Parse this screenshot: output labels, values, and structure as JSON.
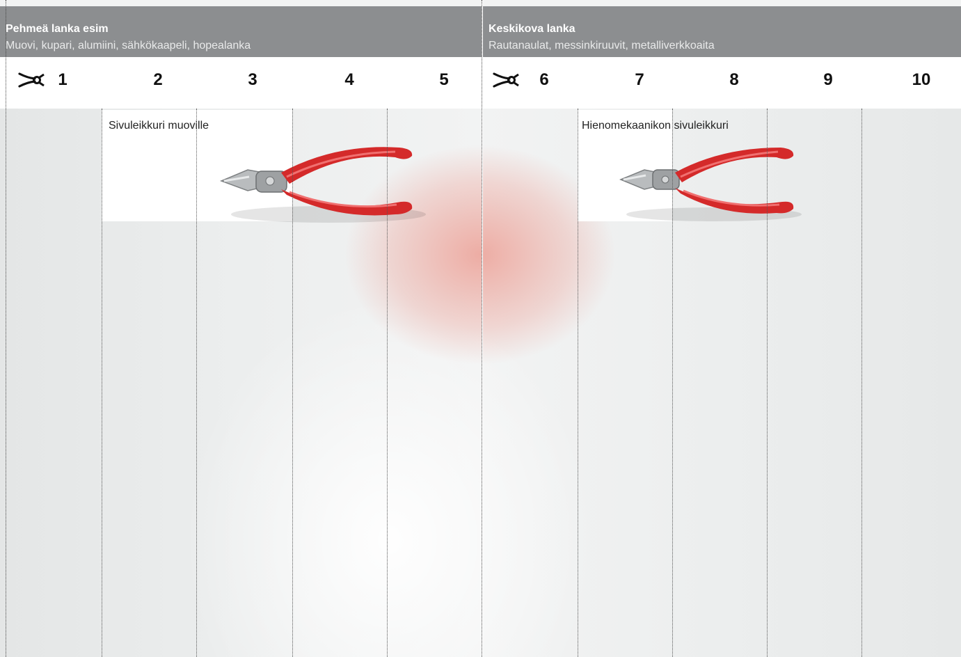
{
  "sections": [
    {
      "title": "Pehmeä lanka esim",
      "subtitle": "Muovi, kupari, alumiini, sähkökaapeli, hopealanka",
      "numbers": [
        "1",
        "2",
        "3",
        "4",
        "5"
      ],
      "tool_label": "Sivuleikkuri muoville"
    },
    {
      "title": "Keskikova lanka",
      "subtitle": "Rautanaulat, messinkiruuvit, metalliverkkoaita",
      "numbers": [
        "6",
        "7",
        "8",
        "9",
        "10"
      ],
      "tool_label": "Hienomekaanikon sivuleikkuri"
    }
  ],
  "icons": {
    "scissors": "scissors-icon",
    "tool": "side-cutter-pliers-icon"
  },
  "colors": {
    "header": "#8c8e90",
    "handle_red": "#d42a2a"
  }
}
